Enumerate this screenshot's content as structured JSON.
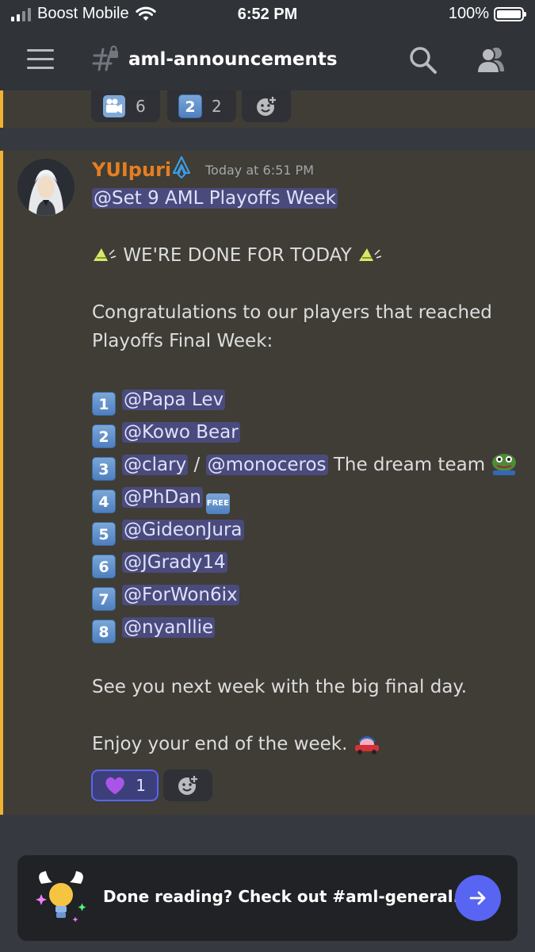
{
  "status_bar": {
    "carrier": "Boost Mobile",
    "time": "6:52 PM",
    "battery": "100%"
  },
  "header": {
    "channel_name": "aml-announcements"
  },
  "previous_message": {
    "reactions": [
      {
        "emoji": "movie-camera-emoji",
        "count": "6"
      },
      {
        "emoji": "keycap-2-emoji",
        "keycap": "2",
        "count": "2"
      }
    ]
  },
  "message": {
    "author": "YUIpuri",
    "author_color": "#e67e22",
    "timestamp": "Today at 6:51 PM",
    "role_mention": "@Set 9 AML Playoffs Week",
    "done_line": "WE'RE DONE FOR TODAY",
    "congrats_line1": "Congratulations to our players that reached",
    "congrats_line2": "Playoffs Final Week:",
    "rankings": [
      {
        "num": "1",
        "mention": "@Papa Lev"
      },
      {
        "num": "2",
        "mention": "@Kowo Bear"
      },
      {
        "num": "3",
        "mention": "@clary",
        "separator": "/",
        "mention2": "@monoceros",
        "suffix": "The dream team"
      },
      {
        "num": "4",
        "mention": "@PhDan",
        "badge": "FREE"
      },
      {
        "num": "5",
        "mention": "@GideonJura"
      },
      {
        "num": "6",
        "mention": "@JGrady14"
      },
      {
        "num": "7",
        "mention": "@ForWon6ix"
      },
      {
        "num": "8",
        "mention": "@nyanllie"
      }
    ],
    "see_you": "See you next week with the big final day.",
    "enjoy": "Enjoy your end of the week.",
    "reactions": [
      {
        "emoji": "purple-heart-emoji",
        "count": "1"
      }
    ]
  },
  "cta": {
    "text": "Done reading? Check out #aml-general."
  },
  "colors": {
    "accent": "#f0b232",
    "blurple": "#5865f2",
    "mention_bg": "#4a4b7c"
  }
}
